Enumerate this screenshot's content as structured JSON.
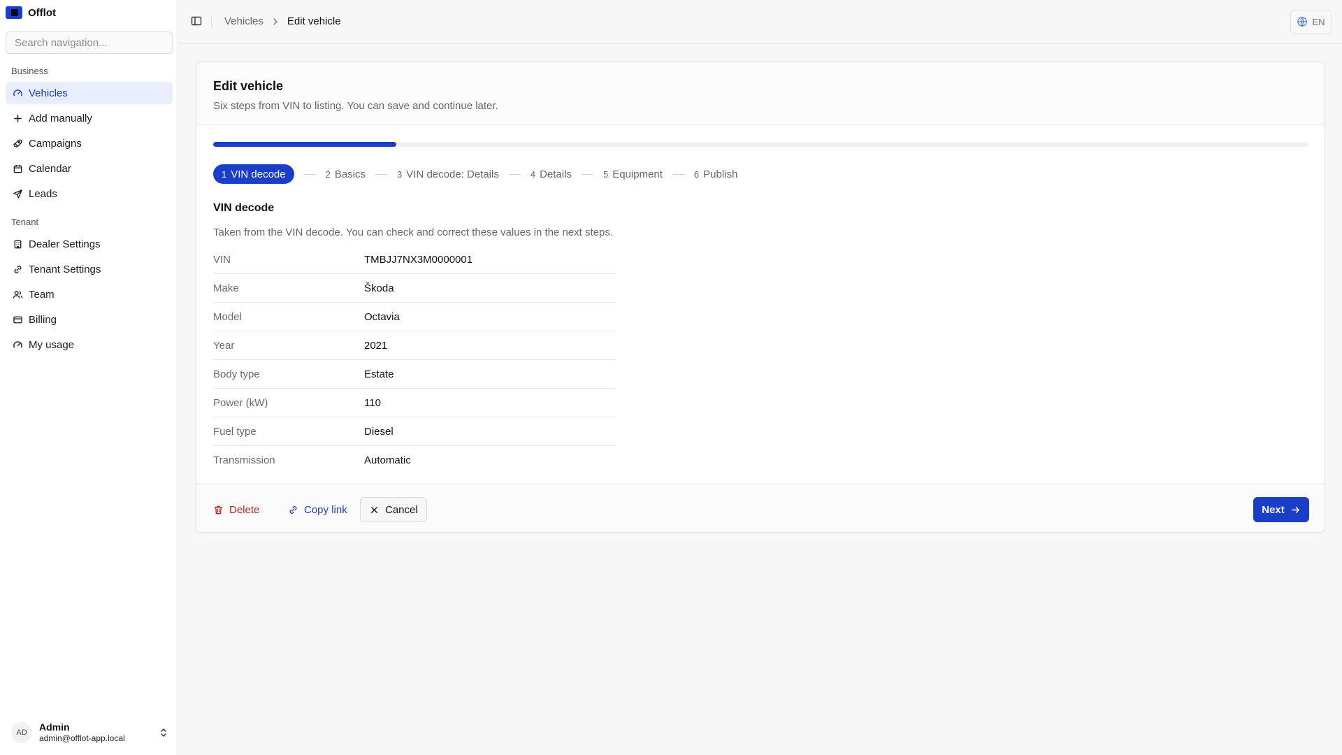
{
  "app": {
    "name": "Offlot"
  },
  "sidebar": {
    "search_placeholder": "Search navigation...",
    "groups": [
      {
        "label": "Business",
        "items": [
          "Vehicles",
          "Add manually",
          "Campaigns",
          "Calendar",
          "Leads"
        ]
      },
      {
        "label": "Tenant",
        "items": [
          "Dealer Settings",
          "Tenant Settings",
          "Team",
          "Billing",
          "My usage"
        ]
      }
    ],
    "active_item": "Vehicles",
    "user": {
      "initials": "AD",
      "name": "Admin",
      "email": "admin@offlot-app.local"
    }
  },
  "topbar": {
    "breadcrumb": {
      "parent": "Vehicles",
      "current": "Edit vehicle"
    },
    "language": "EN"
  },
  "card": {
    "title": "Edit vehicle",
    "subtitle": "Six steps from VIN to listing. You can save and continue later.",
    "progress_fraction": 0.167,
    "steps": [
      {
        "num": "1",
        "label": "VIN decode",
        "active": true
      },
      {
        "num": "2",
        "label": "Basics",
        "active": false
      },
      {
        "num": "3",
        "label": "VIN decode: Details",
        "active": false
      },
      {
        "num": "4",
        "label": "Details",
        "active": false
      },
      {
        "num": "5",
        "label": "Equipment",
        "active": false
      },
      {
        "num": "6",
        "label": "Publish",
        "active": false
      }
    ],
    "section": {
      "title": "VIN decode",
      "description": "Taken from the VIN decode. You can check and correct these values in the next steps.",
      "rows": [
        {
          "key": "VIN",
          "value": "TMBJJ7NX3M0000001"
        },
        {
          "key": "Make",
          "value": "Škoda"
        },
        {
          "key": "Model",
          "value": "Octavia"
        },
        {
          "key": "Year",
          "value": "2021"
        },
        {
          "key": "Body type",
          "value": "Estate"
        },
        {
          "key": "Power (kW)",
          "value": "110"
        },
        {
          "key": "Fuel type",
          "value": "Diesel"
        },
        {
          "key": "Transmission",
          "value": "Automatic"
        }
      ]
    },
    "footer": {
      "delete": "Delete",
      "copy_link": "Copy link",
      "cancel": "Cancel",
      "next": "Next"
    }
  },
  "colors": {
    "accent": "#1b3ec9",
    "danger": "#b02a1e",
    "active_nav_bg": "#e8eefb"
  }
}
